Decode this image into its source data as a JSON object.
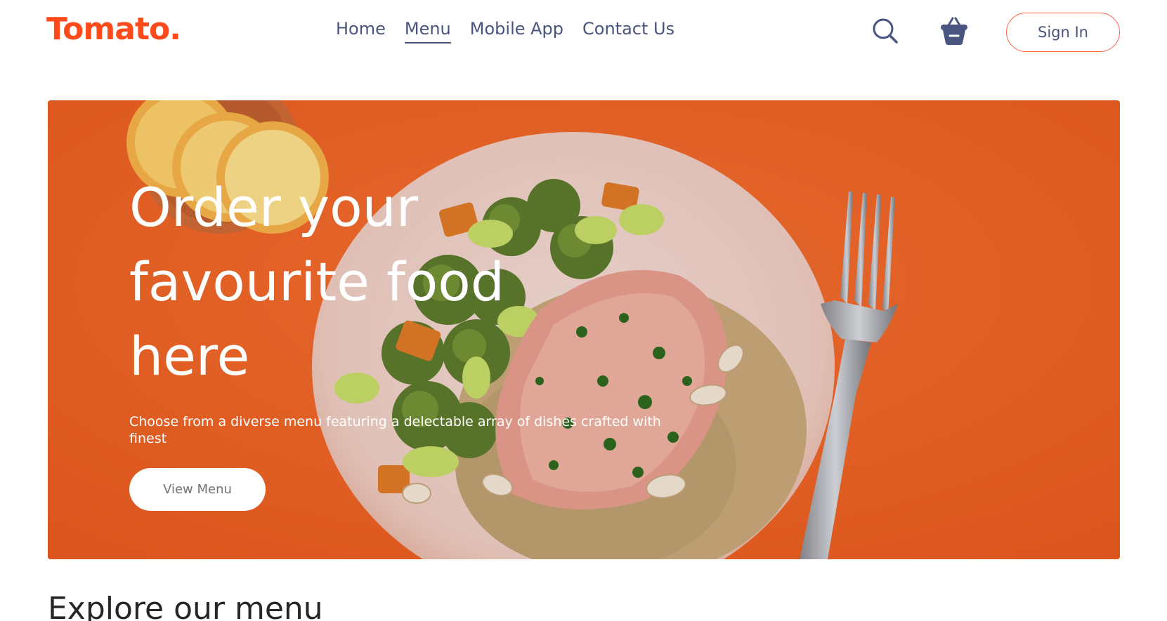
{
  "navbar": {
    "logo": "Tomato.",
    "links": [
      {
        "label": "Home"
      },
      {
        "label": "Menu"
      },
      {
        "label": "Mobile App"
      },
      {
        "label": "Contact Us"
      }
    ],
    "active_link": "Menu",
    "search_icon": "search-icon",
    "basket_icon": "basket-icon",
    "signin_label": "Sign In"
  },
  "hero": {
    "title": "Order your favourite food here",
    "description": "Choose from a diverse menu featuring a delectable array of dishes crafted with finest",
    "button_label": "View Menu"
  },
  "explore": {
    "title": "Explore our menu"
  },
  "colors": {
    "brand": "#ff4a1c",
    "nav_text": "#49557e",
    "hero_bg": "#f06428",
    "signin_border": "#ff6347"
  }
}
